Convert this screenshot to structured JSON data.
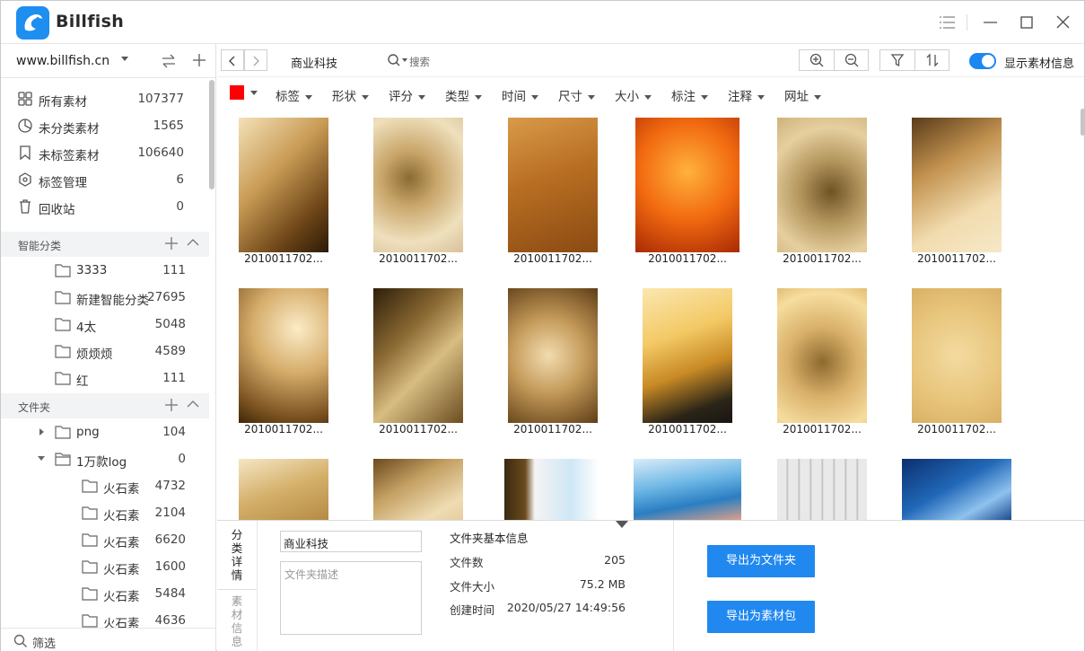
{
  "app": {
    "name": "Billfish"
  },
  "sidebar": {
    "site": "www.billfish.cn",
    "main_items": [
      {
        "label": "所有素材",
        "count": "107377",
        "icon": "grid-icon"
      },
      {
        "label": "未分类素材",
        "count": "1565",
        "icon": "pie-chart-icon"
      },
      {
        "label": "未标签素材",
        "count": "106640",
        "icon": "tag-icon"
      },
      {
        "label": "标签管理",
        "count": "6",
        "icon": "hexagon-icon"
      },
      {
        "label": "回收站",
        "count": "0",
        "icon": "trash-icon"
      }
    ],
    "smart_section": "智能分类",
    "smart_items": [
      {
        "label": "3333",
        "count": "111"
      },
      {
        "label": "新建智能分类",
        "count": "27695"
      },
      {
        "label": "4太",
        "count": "5048"
      },
      {
        "label": "烦烦烦",
        "count": "4589"
      },
      {
        "label": "红",
        "count": "111"
      }
    ],
    "folder_section": "文件夹",
    "folders": [
      {
        "label": "png",
        "count": "104"
      },
      {
        "label": "1万款log",
        "count": "0"
      }
    ],
    "subfolders": [
      {
        "label": "火石素",
        "count": "4732"
      },
      {
        "label": "火石素",
        "count": "2104"
      },
      {
        "label": "火石素",
        "count": "6620"
      },
      {
        "label": "火石素",
        "count": "1600"
      },
      {
        "label": "火石素",
        "count": "5484"
      },
      {
        "label": "火石素",
        "count": "4636"
      }
    ],
    "filter_label": "筛选"
  },
  "toolbar": {
    "breadcrumb": "商业科技",
    "search_label": "搜索",
    "toggle_label": "显示素材信息",
    "toggle_on": true
  },
  "filters": {
    "color": "#ff0000",
    "chips": [
      "标签",
      "形状",
      "评分",
      "类型",
      "时间",
      "尺寸",
      "大小",
      "标注",
      "注释",
      "网址"
    ]
  },
  "thumbnails": {
    "captions": [
      "2010011702...",
      "2010011702...",
      "2010011702...",
      "2010011702...",
      "2010011702...",
      "2010011702...",
      "2010011702...",
      "2010011702...",
      "2010011702...",
      "2010011702...",
      "2010011702...",
      "2010011702..."
    ]
  },
  "panel": {
    "tab_category": "分类详情",
    "tab_material": "素材信息",
    "folder_name": "商业科技",
    "desc_placeholder": "文件夹描述",
    "info_title": "文件夹基本信息",
    "file_count_label": "文件数",
    "file_count": "205",
    "file_size_label": "文件大小",
    "file_size": "75.2 MB",
    "created_label": "创建时间",
    "created": "2020/05/27 14:49:56",
    "export_folder": "导出为文件夹",
    "export_pack": "导出为素材包"
  }
}
